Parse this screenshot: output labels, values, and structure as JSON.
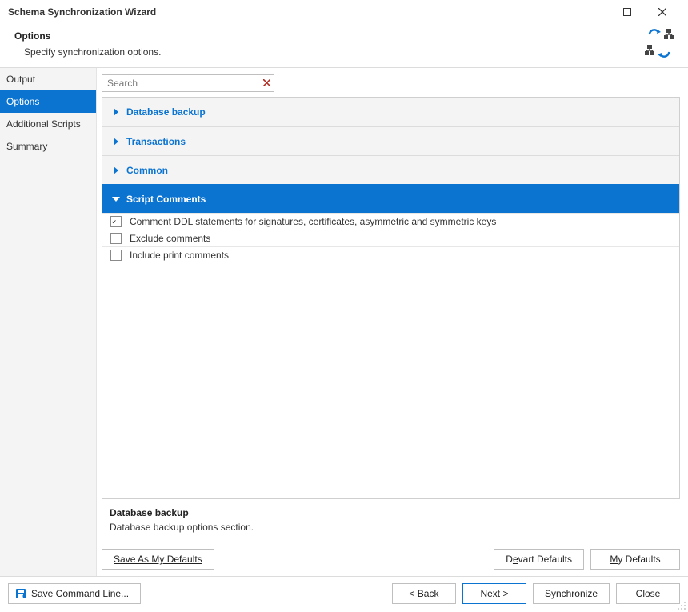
{
  "window": {
    "title": "Schema Synchronization Wizard"
  },
  "header": {
    "heading": "Options",
    "subtitle": "Specify synchronization options."
  },
  "sidebar": {
    "items": [
      {
        "label": "Output",
        "active": false
      },
      {
        "label": "Options",
        "active": true
      },
      {
        "label": "Additional Scripts",
        "active": false
      },
      {
        "label": "Summary",
        "active": false
      }
    ]
  },
  "search": {
    "placeholder": "Search",
    "value": ""
  },
  "groups": {
    "database_backup": {
      "label": "Database backup",
      "expanded": false
    },
    "transactions": {
      "label": "Transactions",
      "expanded": false
    },
    "common": {
      "label": "Common",
      "expanded": false
    },
    "script_comments": {
      "label": "Script Comments",
      "expanded": true,
      "options": [
        {
          "label": "Comment DDL statements for signatures, certificates, asymmetric and symmetric keys",
          "checked": true
        },
        {
          "label": "Exclude comments",
          "checked": false
        },
        {
          "label": "Include print comments",
          "checked": false
        }
      ]
    }
  },
  "help": {
    "title": "Database backup",
    "desc": "Database backup options section."
  },
  "defaults": {
    "save_as": "Save As My Defaults",
    "devart": {
      "pre": "D",
      "ul": "e",
      "post": "vart Defaults"
    },
    "my": {
      "pre": "",
      "ul": "M",
      "post": "y Defaults"
    }
  },
  "footer": {
    "save_cmd": "Save Command Line...",
    "back": {
      "pre": "< ",
      "ul": "B",
      "post": "ack"
    },
    "next": {
      "pre": "",
      "ul": "N",
      "post": "ext >"
    },
    "sync": "Synchronize",
    "close": {
      "pre": "",
      "ul": "C",
      "post": "lose"
    }
  }
}
